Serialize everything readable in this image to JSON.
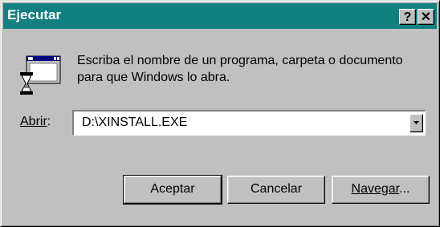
{
  "window": {
    "title": "Ejecutar",
    "help_label": "?",
    "close_label": "✕"
  },
  "message": "Escriba el nombre de un programa, carpeta o documento para que Windows lo abra.",
  "open": {
    "label_main": "Abrir",
    "label_suffix": ":",
    "value": "D:\\XINSTALL.EXE"
  },
  "buttons": {
    "ok": "Aceptar",
    "cancel": "Cancelar",
    "browse_main": "Navegar",
    "browse_suffix": "..."
  },
  "colors": {
    "titlebar": "#138080",
    "face": "#c0c0c0"
  },
  "icons": {
    "program": "run-program-icon",
    "dropdown": "dropdown-arrow-icon"
  }
}
